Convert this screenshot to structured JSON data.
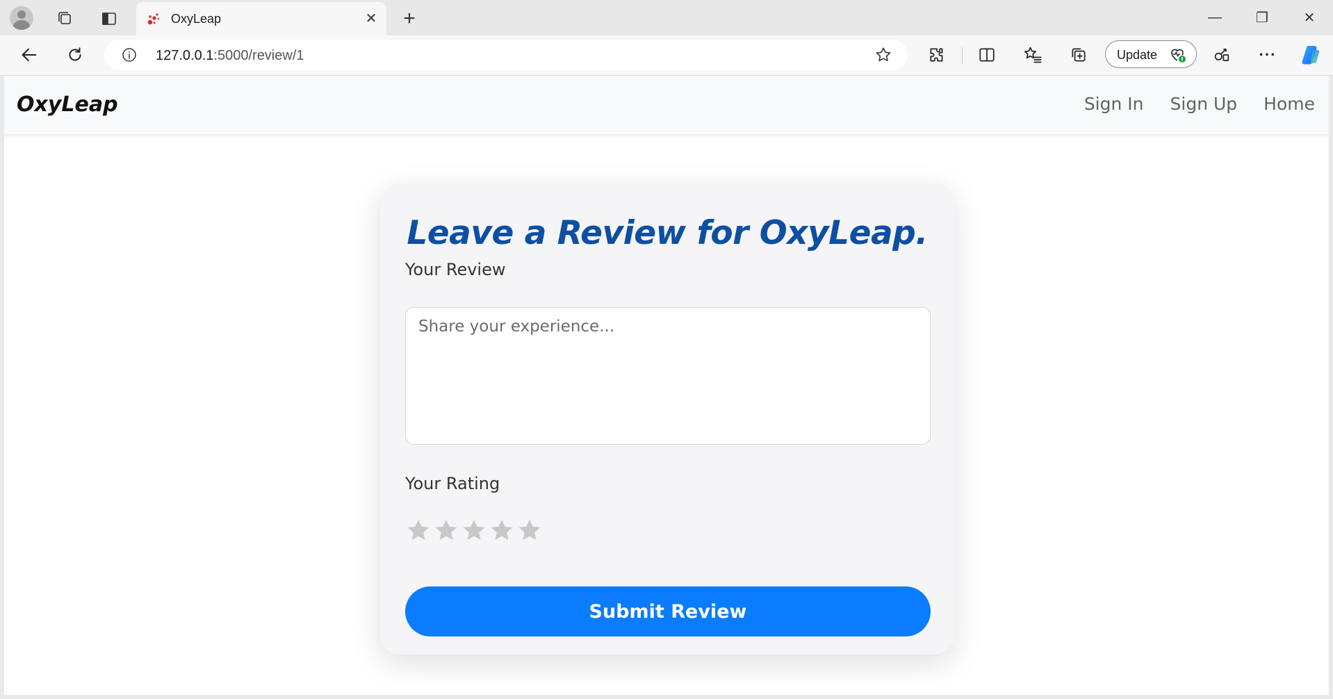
{
  "browser": {
    "tab_title": "OxyLeap",
    "tab_close_glyph": "✕",
    "new_tab_glyph": "+",
    "window_minimize_glyph": "—",
    "window_restore_glyph": "❐",
    "window_close_glyph": "✕",
    "url_host": "127.0.0.1",
    "url_path": ":5000/review/1",
    "update_label": "Update",
    "more_glyph": "···"
  },
  "site": {
    "brand": "OxyLeap",
    "nav": [
      {
        "label": "Sign In"
      },
      {
        "label": "Sign Up"
      },
      {
        "label": "Home"
      }
    ]
  },
  "review_form": {
    "title": "Leave a Review for OxyLeap.",
    "review_label": "Your Review",
    "review_placeholder": "Share your experience...",
    "review_value": "",
    "rating_label": "Your Rating",
    "rating_max": 5,
    "rating_value": 0,
    "submit_label": "Submit Review"
  },
  "colors": {
    "accent": "#0a7cff",
    "title": "#0d4fa3",
    "star_empty": "#c8c8c8"
  }
}
